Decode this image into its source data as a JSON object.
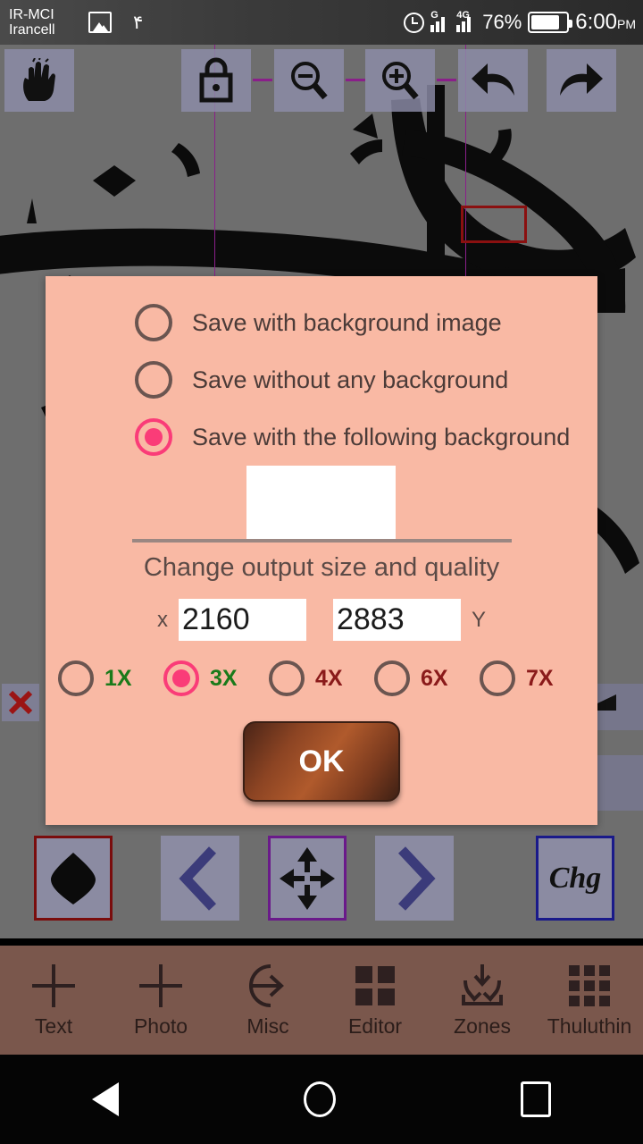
{
  "statusbar": {
    "carrier_line1": "IR-MCI",
    "carrier_line2": "Irancell",
    "photo_icon": "picture-icon",
    "notification_count": "۴",
    "alarm_icon": "alarm-clock-icon",
    "signal1_label": "G",
    "signal2_label": "4G",
    "battery_percent": "76%",
    "battery_icon": "battery-icon",
    "time": "6:00",
    "time_suffix": "PM"
  },
  "toolbar": {
    "buttons": [
      {
        "name": "hand-tool",
        "icon": "hand-icon"
      },
      {
        "name": "lock-tool",
        "icon": "lock-icon"
      },
      {
        "name": "zoom-out-tool",
        "icon": "zoom-out-icon"
      },
      {
        "name": "zoom-in-tool",
        "icon": "zoom-in-icon"
      },
      {
        "name": "undo-tool",
        "icon": "undo-arrow-icon"
      },
      {
        "name": "redo-tool",
        "icon": "redo-arrow-icon"
      }
    ]
  },
  "canvas": {
    "close_icon": "close-x-icon",
    "background_color": "#6e6e6e",
    "guide_color": "#8a1f8a",
    "selection_color": "#8a1010"
  },
  "control_strip": {
    "buttons": [
      {
        "name": "shape-diamond-button",
        "icon": "diamond-icon",
        "border": "#7a0d0d"
      },
      {
        "name": "previous-button",
        "icon": "chevron-left-icon",
        "border": "none"
      },
      {
        "name": "move-button",
        "icon": "move-arrows-icon",
        "border": "#6a1a8a"
      },
      {
        "name": "next-button",
        "icon": "chevron-right-icon",
        "border": "none"
      },
      {
        "name": "change-button",
        "label": "Chg",
        "border": "#1a1a8a"
      }
    ]
  },
  "bottom_nav": {
    "items": [
      {
        "label": "Text",
        "icon": "plus-icon"
      },
      {
        "label": "Photo",
        "icon": "plus-icon"
      },
      {
        "label": "Misc",
        "icon": "arrow-into-circle-icon"
      },
      {
        "label": "Editor",
        "icon": "grid-four-icon"
      },
      {
        "label": "Zones",
        "icon": "download-into-tray-icon"
      },
      {
        "label": "Thuluthin",
        "icon": "grid-nine-icon"
      }
    ]
  },
  "android_nav": {
    "back": "back-triangle-icon",
    "home": "home-circle-icon",
    "recents": "recents-square-icon"
  },
  "dialog": {
    "background_color": "#f9b9a4",
    "accent_color": "#fa3c78",
    "options": [
      {
        "label": "Save with background image",
        "selected": false
      },
      {
        "label": "Save without any background",
        "selected": false
      },
      {
        "label": "Save with the following background",
        "selected": true
      }
    ],
    "background_swatch_color": "#ffffff",
    "section_title": "Change output size and quality",
    "size": {
      "x_label": "x",
      "x_value": "2160",
      "y_value": "2883",
      "y_label": "Y"
    },
    "multipliers": [
      {
        "label": "1X",
        "selected": false,
        "color": "#1a7a1a"
      },
      {
        "label": "3X",
        "selected": true,
        "color": "#1a7a1a"
      },
      {
        "label": "4X",
        "selected": false,
        "color": "#8a1a1a"
      },
      {
        "label": "6X",
        "selected": false,
        "color": "#8a1a1a"
      },
      {
        "label": "7X",
        "selected": false,
        "color": "#8a1a1a"
      }
    ],
    "ok_label": "OK"
  }
}
